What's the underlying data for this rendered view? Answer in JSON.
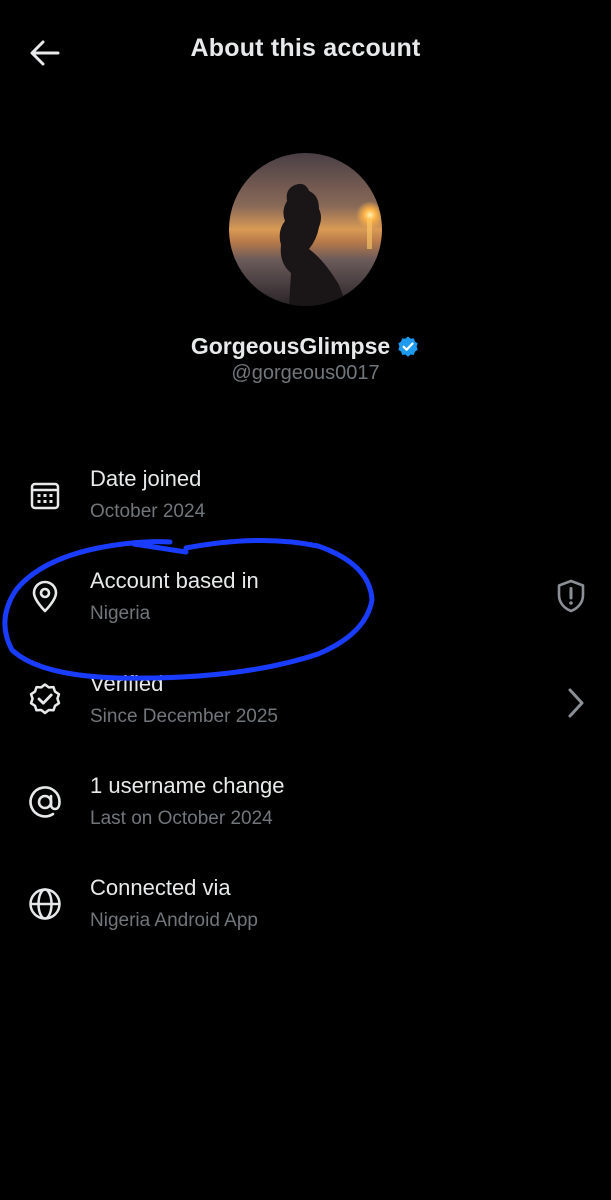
{
  "header": {
    "title": "About this account",
    "back_icon": "arrow-left-icon"
  },
  "profile": {
    "display_name": "GorgeousGlimpse",
    "handle": "@gorgeous0017",
    "verified": true,
    "badge_color": "#1d9bf0"
  },
  "items": [
    {
      "title": "Date joined",
      "subtitle": "October 2024",
      "icon": "calendar-icon"
    },
    {
      "title": "Account based in",
      "subtitle": "Nigeria",
      "icon": "location-pin-icon",
      "action_icon": "shield-alert-icon"
    },
    {
      "title": "Verified",
      "subtitle": "Since December 2025",
      "icon": "verified-check-icon",
      "action_icon": "chevron-right-icon"
    },
    {
      "title": "1 username change",
      "subtitle": "Last on October 2024",
      "icon": "at-sign-icon"
    },
    {
      "title": "Connected via",
      "subtitle": "Nigeria Android App",
      "icon": "globe-icon"
    }
  ],
  "colors": {
    "background": "#000000",
    "primary_text": "#e7e9ea",
    "secondary_text": "#71767b",
    "annotation": "#1a3cff"
  }
}
